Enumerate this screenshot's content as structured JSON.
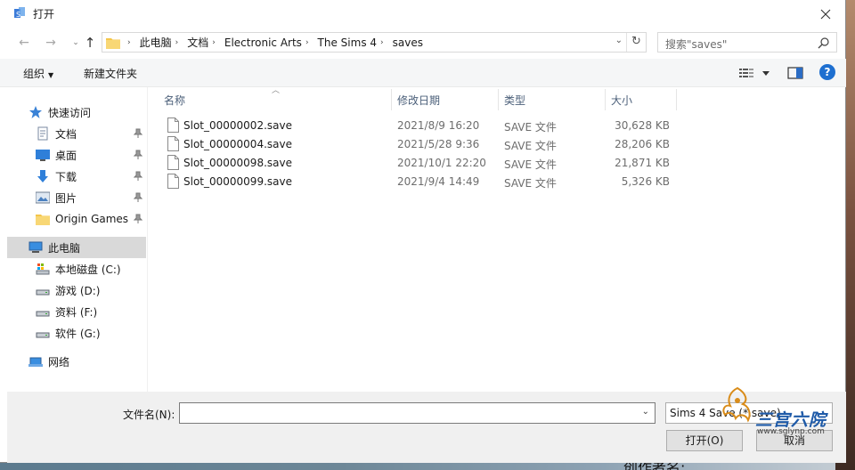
{
  "dialog": {
    "title": "打开"
  },
  "address": {
    "breadcrumbs": [
      "此电脑",
      "文档",
      "Electronic Arts",
      "The Sims 4",
      "saves"
    ]
  },
  "search": {
    "placeholder": "搜索\"saves\""
  },
  "toolbar": {
    "organize_label": "组织",
    "new_folder_label": "新建文件夹"
  },
  "nav_pane": {
    "quick_access": "快速访问",
    "pinned": [
      {
        "label": "文档",
        "icon": "documents-icon"
      },
      {
        "label": "桌面",
        "icon": "desktop-icon"
      },
      {
        "label": "下载",
        "icon": "download-icon"
      },
      {
        "label": "图片",
        "icon": "pictures-icon"
      },
      {
        "label": "Origin Games",
        "icon": "folder-icon"
      }
    ],
    "this_pc": "此电脑",
    "drives": [
      {
        "label": "本地磁盘 (C:)",
        "icon": "system-drive-icon"
      },
      {
        "label": "游戏 (D:)",
        "icon": "drive-icon"
      },
      {
        "label": "资料 (F:)",
        "icon": "drive-icon"
      },
      {
        "label": "软件 (G:)",
        "icon": "drive-icon"
      }
    ],
    "network": "网络"
  },
  "file_list": {
    "columns": [
      "名称",
      "修改日期",
      "类型",
      "大小"
    ],
    "rows": [
      {
        "name": "Slot_00000002.save",
        "date": "2021/8/9 16:20",
        "type": "SAVE 文件",
        "size": "30,628 KB"
      },
      {
        "name": "Slot_00000004.save",
        "date": "2021/5/28 9:36",
        "type": "SAVE 文件",
        "size": "28,206 KB"
      },
      {
        "name": "Slot_00000098.save",
        "date": "2021/10/1 22:20",
        "type": "SAVE 文件",
        "size": "21,871 KB"
      },
      {
        "name": "Slot_00000099.save",
        "date": "2021/9/4 14:49",
        "type": "SAVE 文件",
        "size": "5,326 KB"
      }
    ]
  },
  "bottom": {
    "filename_label": "文件名(N):",
    "filename_value": "",
    "filter_value": "Sims 4 Save (*.save)",
    "open_label": "打开(O)",
    "cancel_label": "取消"
  },
  "watermark": {
    "text": "三宫六院",
    "url": "www.sglynp.com"
  },
  "background": {
    "caption": "创作者名:"
  },
  "colors": {
    "accent": "#1e6fd0",
    "selected_row": "#d9d9d9",
    "header_text": "#4c607a"
  }
}
